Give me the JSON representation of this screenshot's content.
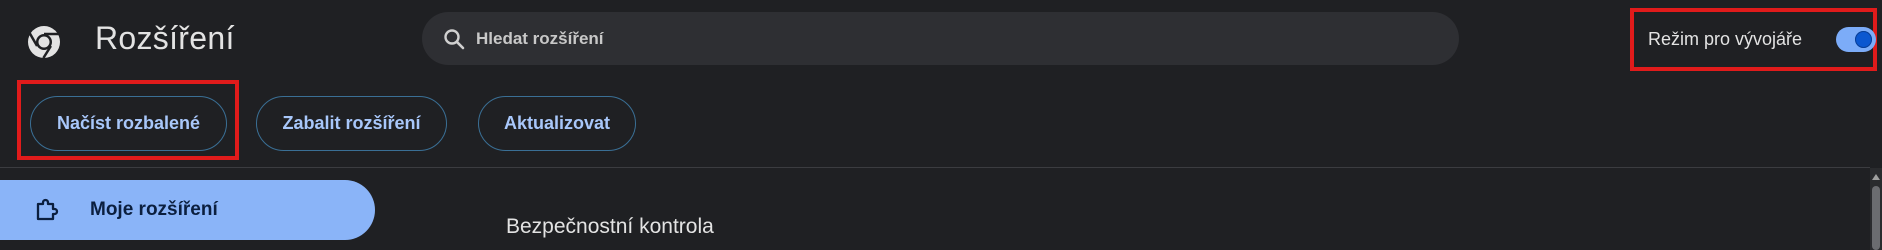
{
  "header": {
    "logo_icon": "chrome-logo-icon",
    "title": "Rozšíření",
    "search": {
      "icon": "search-icon",
      "placeholder": "Hledat rozšíření"
    },
    "developer_mode": {
      "label": "Režim pro vývojáře",
      "enabled": true
    }
  },
  "toolbar": {
    "load_unpacked_label": "Načíst rozbalené",
    "pack_label": "Zabalit rozšíření",
    "update_label": "Aktualizovat"
  },
  "sidebar": {
    "items": [
      {
        "label": "Moje rozšíření",
        "icon": "extension-puzzle-icon",
        "selected": true
      }
    ]
  },
  "main": {
    "section_title": "Bezpečnostní kontrola"
  },
  "colors": {
    "background": "#1f2023",
    "accent": "#8ab4f8",
    "button_text": "#a8c7fa",
    "highlight_border": "#e01b1b"
  }
}
